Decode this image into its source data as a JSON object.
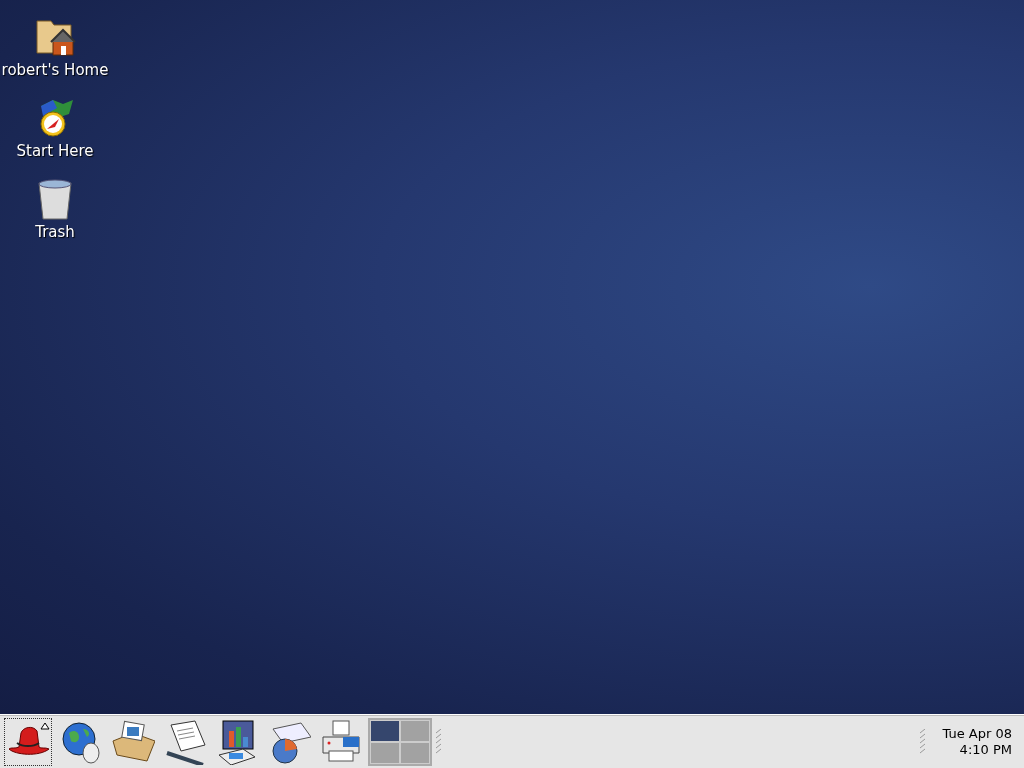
{
  "desktop_icons": [
    {
      "kind": "home",
      "label": "robert's Home"
    },
    {
      "kind": "start",
      "label": "Start Here"
    },
    {
      "kind": "trash",
      "label": "Trash"
    }
  ],
  "panel": {
    "launchers": [
      {
        "kind": "menu"
      },
      {
        "kind": "browser"
      },
      {
        "kind": "mail"
      },
      {
        "kind": "writer"
      },
      {
        "kind": "presentation"
      },
      {
        "kind": "spreadsheet"
      },
      {
        "kind": "printer"
      }
    ],
    "workspaces": [
      {
        "selected": true
      },
      {
        "selected": false
      },
      {
        "selected": false
      },
      {
        "selected": false
      }
    ],
    "clock": {
      "date": "Tue Apr 08",
      "time": "4:10 PM"
    }
  }
}
